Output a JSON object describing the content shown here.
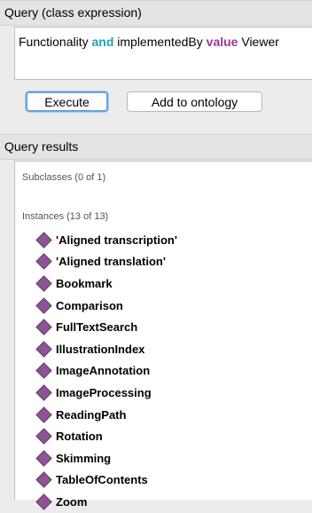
{
  "query": {
    "header": "Query (class expression)",
    "expression": {
      "part1": "Functionality ",
      "kw_and": "and",
      "part2": " implementedBy ",
      "kw_value": "value",
      "part3": " Viewer"
    },
    "execute_label": "Execute",
    "add_label": "Add to ontology"
  },
  "results": {
    "header": "Query results",
    "subclasses_label": "Subclasses (0 of 1)",
    "instances_label": "Instances (13 of 13)",
    "instances": [
      "'Aligned transcription'",
      "'Aligned translation'",
      "Bookmark",
      "Comparison",
      "FullTextSearch",
      "IllustrationIndex",
      "ImageAnnotation",
      "ImageProcessing",
      "ReadingPath",
      "Rotation",
      "Skimming",
      "TableOfContents",
      "Zoom"
    ]
  },
  "colors": {
    "keyword_and": "#20a1b6",
    "keyword_value": "#a0359a",
    "individual_icon": "#8d5494"
  },
  "icons": {
    "individual": "individual-diamond-icon"
  }
}
